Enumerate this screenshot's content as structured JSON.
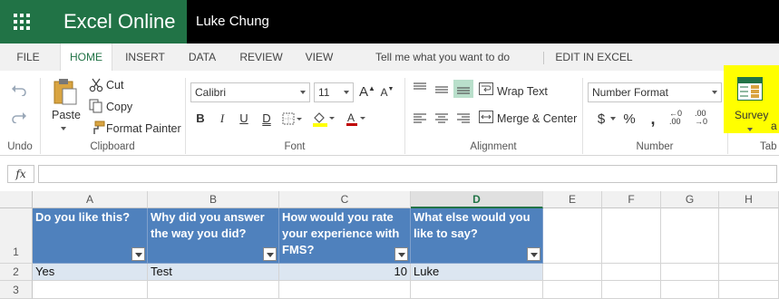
{
  "app": {
    "name": "Excel Online",
    "user": "Luke Chung"
  },
  "tabs": [
    {
      "label": "FILE"
    },
    {
      "label": "HOME"
    },
    {
      "label": "INSERT"
    },
    {
      "label": "DATA"
    },
    {
      "label": "REVIEW"
    },
    {
      "label": "VIEW"
    },
    {
      "label": "Tell me what you want to do"
    },
    {
      "label": "EDIT IN EXCEL"
    }
  ],
  "ribbon": {
    "groups": {
      "undo": "Undo",
      "clipboard": "Clipboard",
      "font": "Font",
      "alignment": "Alignment",
      "number": "Number",
      "tables": "Tab"
    },
    "clipboard": {
      "paste": "Paste",
      "cut": "Cut",
      "copy": "Copy",
      "format_painter": "Format Painter"
    },
    "font": {
      "name": "Calibri",
      "size": "11",
      "grow": "A",
      "shrink": "A",
      "bold": "B",
      "italic": "I",
      "underline": "U",
      "double_underline": "D",
      "font_color_letter": "A"
    },
    "alignment": {
      "wrap_text": "Wrap Text",
      "merge_center": "Merge & Center"
    },
    "number": {
      "format": "Number Format",
      "currency": "$",
      "percent": "%",
      "comma": ",",
      "inc_decimal": ".00",
      "dec_decimal": ".00"
    },
    "tables": {
      "survey": "Survey",
      "extra": "a"
    }
  },
  "formula_bar": {
    "fx": "fx",
    "value": ""
  },
  "sheet": {
    "columns": [
      "A",
      "B",
      "C",
      "D",
      "E",
      "F",
      "G",
      "H"
    ],
    "selected_column": "D",
    "rows": [
      "1",
      "2",
      "3"
    ],
    "header_cells": [
      "Do you like this?",
      "Why did you answer the way you did?",
      "How would you rate your experience with FMS?",
      "What else would you like to say?"
    ],
    "data_row": [
      "Yes",
      "Test",
      "10",
      "Luke"
    ]
  },
  "colors": {
    "brand": "#217346",
    "table_header": "#4f81bd",
    "table_band": "#dce6f1",
    "highlight": "#ffff00"
  }
}
